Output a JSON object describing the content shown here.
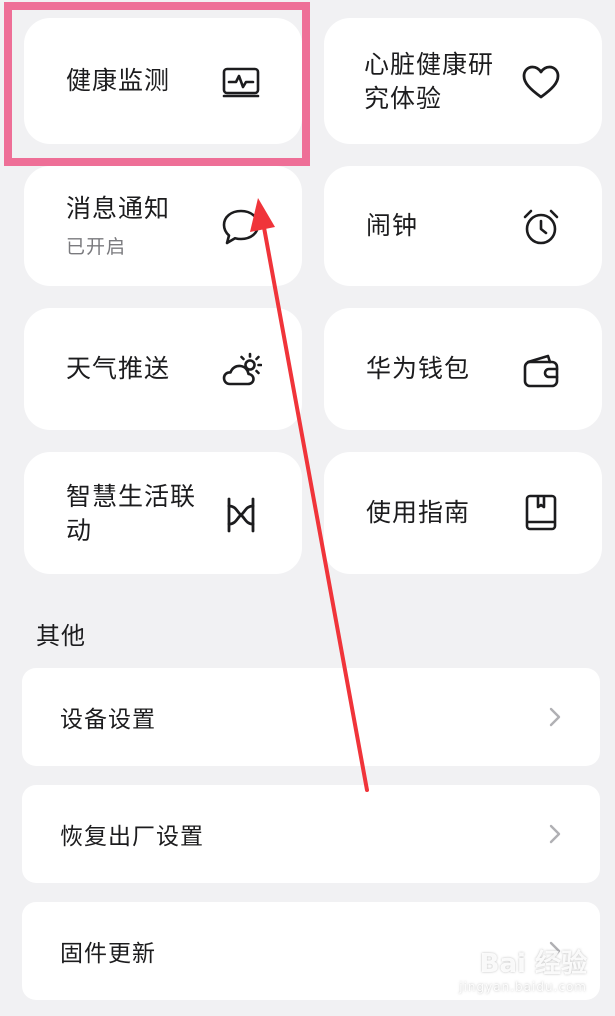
{
  "tiles": [
    {
      "label": "健康监测",
      "icon": "activity-monitor-icon"
    },
    {
      "label": "心脏健康研\n究体验",
      "icon": "heart-icon"
    },
    {
      "label": "消息通知",
      "sublabel": "已开启",
      "icon": "chat-bubble-icon"
    },
    {
      "label": "闹钟",
      "icon": "alarm-clock-icon"
    },
    {
      "label": "天气推送",
      "icon": "weather-cloud-sun-icon"
    },
    {
      "label": "华为钱包",
      "icon": "wallet-icon"
    },
    {
      "label": "智慧生活联\n动",
      "icon": "smart-life-link-icon"
    },
    {
      "label": "使用指南",
      "icon": "guide-book-icon"
    }
  ],
  "other_section": {
    "title": "其他",
    "rows": [
      {
        "label": "设备设置"
      },
      {
        "label": "恢复出厂设置"
      },
      {
        "label": "固件更新"
      }
    ]
  },
  "annotation": {
    "highlight_color": "#ee6f97",
    "arrow_color": "#f0343a"
  },
  "watermark": {
    "main": "Bai 经验",
    "url": "jingyan.baidu.com"
  }
}
